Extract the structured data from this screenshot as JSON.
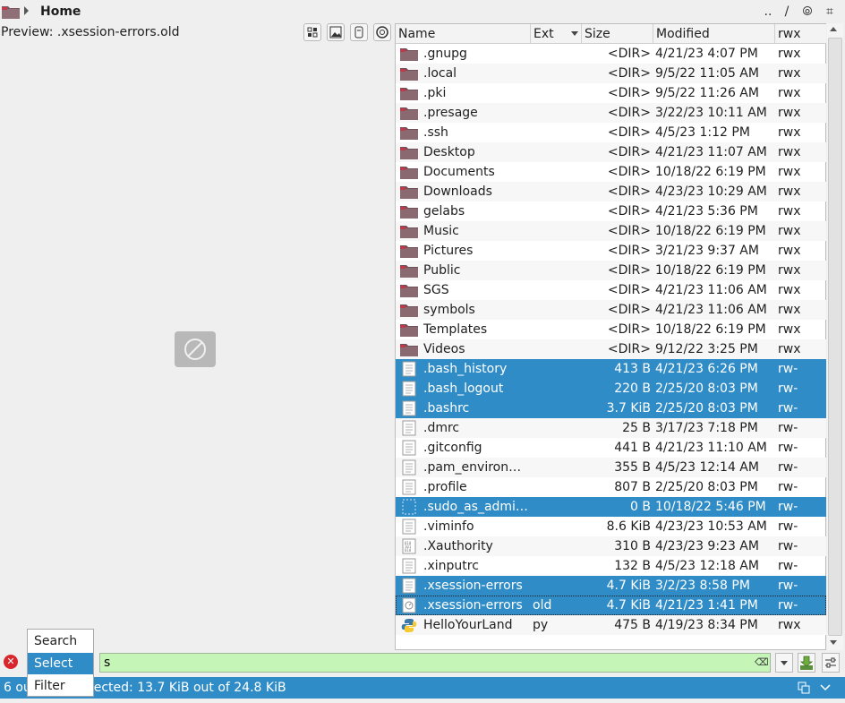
{
  "topbar": {
    "title": "Home",
    "tools": [
      "..",
      "/",
      "⦾",
      "⌗"
    ]
  },
  "preview": {
    "label": "Preview: .xsession-errors.old"
  },
  "columns": {
    "name": "Name",
    "ext": "Ext",
    "size": "Size",
    "modified": "Modified",
    "rwx": "rwx"
  },
  "files": [
    {
      "name": ".gnupg",
      "ext": "",
      "size": "<DIR>",
      "modified": "4/21/23 4:07 PM",
      "rwx": "rwx",
      "icon": "folder",
      "selected": false
    },
    {
      "name": ".local",
      "ext": "",
      "size": "<DIR>",
      "modified": "9/5/22 11:05 AM",
      "rwx": "rwx",
      "icon": "folder",
      "selected": false
    },
    {
      "name": ".pki",
      "ext": "",
      "size": "<DIR>",
      "modified": "9/5/22 11:26 AM",
      "rwx": "rwx",
      "icon": "folder",
      "selected": false
    },
    {
      "name": ".presage",
      "ext": "",
      "size": "<DIR>",
      "modified": "3/22/23 10:11 AM",
      "rwx": "rwx",
      "icon": "folder",
      "selected": false
    },
    {
      "name": ".ssh",
      "ext": "",
      "size": "<DIR>",
      "modified": "4/5/23 1:12 PM",
      "rwx": "rwx",
      "icon": "folder",
      "selected": false
    },
    {
      "name": "Desktop",
      "ext": "",
      "size": "<DIR>",
      "modified": "4/21/23 11:07 AM",
      "rwx": "rwx",
      "icon": "folder",
      "selected": false
    },
    {
      "name": "Documents",
      "ext": "",
      "size": "<DIR>",
      "modified": "10/18/22 6:19 PM",
      "rwx": "rwx",
      "icon": "folder",
      "selected": false
    },
    {
      "name": "Downloads",
      "ext": "",
      "size": "<DIR>",
      "modified": "4/23/23 10:29 AM",
      "rwx": "rwx",
      "icon": "folder",
      "selected": false
    },
    {
      "name": "gelabs",
      "ext": "",
      "size": "<DIR>",
      "modified": "4/21/23 5:36 PM",
      "rwx": "rwx",
      "icon": "folder",
      "selected": false
    },
    {
      "name": "Music",
      "ext": "",
      "size": "<DIR>",
      "modified": "10/18/22 6:19 PM",
      "rwx": "rwx",
      "icon": "folder",
      "selected": false
    },
    {
      "name": "Pictures",
      "ext": "",
      "size": "<DIR>",
      "modified": "3/21/23 9:37 AM",
      "rwx": "rwx",
      "icon": "folder",
      "selected": false
    },
    {
      "name": "Public",
      "ext": "",
      "size": "<DIR>",
      "modified": "10/18/22 6:19 PM",
      "rwx": "rwx",
      "icon": "folder",
      "selected": false
    },
    {
      "name": "SGS",
      "ext": "",
      "size": "<DIR>",
      "modified": "4/21/23 11:06 AM",
      "rwx": "rwx",
      "icon": "folder",
      "selected": false
    },
    {
      "name": "symbols",
      "ext": "",
      "size": "<DIR>",
      "modified": "4/21/23 11:06 AM",
      "rwx": "rwx",
      "icon": "folder",
      "selected": false
    },
    {
      "name": "Templates",
      "ext": "",
      "size": "<DIR>",
      "modified": "10/18/22 6:19 PM",
      "rwx": "rwx",
      "icon": "folder",
      "selected": false
    },
    {
      "name": "Videos",
      "ext": "",
      "size": "<DIR>",
      "modified": "9/12/22 3:25 PM",
      "rwx": "rwx",
      "icon": "folder",
      "selected": false
    },
    {
      "name": ".bash_history",
      "ext": "",
      "size": "413 B",
      "modified": "4/21/23 6:26 PM",
      "rwx": "rw-",
      "icon": "text",
      "selected": true
    },
    {
      "name": ".bash_logout",
      "ext": "",
      "size": "220 B",
      "modified": "2/25/20 8:03 PM",
      "rwx": "rw-",
      "icon": "text",
      "selected": true
    },
    {
      "name": ".bashrc",
      "ext": "",
      "size": "3.7 KiB",
      "modified": "2/25/20 8:03 PM",
      "rwx": "rw-",
      "icon": "text",
      "selected": true
    },
    {
      "name": ".dmrc",
      "ext": "",
      "size": "25 B",
      "modified": "3/17/23 7:18 PM",
      "rwx": "rw-",
      "icon": "text",
      "selected": false
    },
    {
      "name": ".gitconfig",
      "ext": "",
      "size": "441 B",
      "modified": "4/21/23 11:10 AM",
      "rwx": "rw-",
      "icon": "text",
      "selected": false
    },
    {
      "name": ".pam_environ…",
      "ext": "",
      "size": "355 B",
      "modified": "4/5/23 12:14 AM",
      "rwx": "rw-",
      "icon": "text",
      "selected": false
    },
    {
      "name": ".profile",
      "ext": "",
      "size": "807 B",
      "modified": "2/25/20 8:03 PM",
      "rwx": "rw-",
      "icon": "text",
      "selected": false
    },
    {
      "name": ".sudo_as_admi…",
      "ext": "",
      "size": "0 B",
      "modified": "10/18/22 5:46 PM",
      "rwx": "rw-",
      "icon": "empty",
      "selected": true
    },
    {
      "name": ".viminfo",
      "ext": "",
      "size": "8.6 KiB",
      "modified": "4/23/23 10:53 AM",
      "rwx": "rw-",
      "icon": "text",
      "selected": false
    },
    {
      "name": ".Xauthority",
      "ext": "",
      "size": "310 B",
      "modified": "4/23/23 9:23 AM",
      "rwx": "rw-",
      "icon": "binary",
      "selected": false
    },
    {
      "name": ".xinputrc",
      "ext": "",
      "size": "132 B",
      "modified": "4/5/23 12:18 AM",
      "rwx": "rw-",
      "icon": "text",
      "selected": false
    },
    {
      "name": ".xsession-errors",
      "ext": "",
      "size": "4.7 KiB",
      "modified": "3/2/23 8:58 PM",
      "rwx": "rw-",
      "icon": "text",
      "selected": true
    },
    {
      "name": ".xsession-errors",
      "ext": "old",
      "size": "4.7 KiB",
      "modified": "4/21/23 1:41 PM",
      "rwx": "rw-",
      "icon": "log",
      "selected": true,
      "focused": true
    },
    {
      "name": "HelloYourLand",
      "ext": "py",
      "size": "475 B",
      "modified": "4/19/23 8:34 PM",
      "rwx": "rwx",
      "icon": "python",
      "selected": false
    }
  ],
  "search": {
    "value": "s",
    "modes": [
      "Search",
      "Select",
      "Filter"
    ],
    "active_mode": "Select"
  },
  "status": {
    "text": "6 out of 30 selected: 13.7 KiB out of 24.8 KiB"
  },
  "colors": {
    "selection": "#308cc6",
    "search_match": "#c6f5b8",
    "folder": "#8a6a70"
  }
}
